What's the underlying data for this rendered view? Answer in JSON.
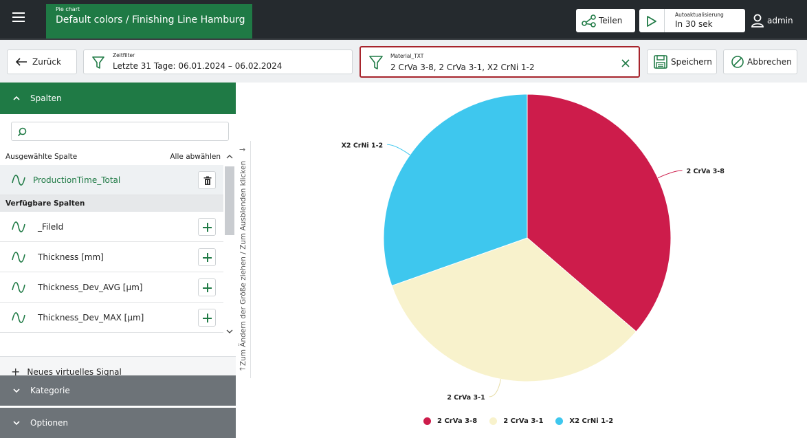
{
  "header": {
    "menu_icon": "hamburger-menu-icon",
    "title_small": "Pie chart",
    "title_main": "Default colors / Finishing Line Hamburg",
    "share_label": "Teilen",
    "share_icon": "share-network-icon",
    "auto_small": "Autoaktualisierung",
    "auto_main": "In 30 sek",
    "auto_icon": "play-icon",
    "user_label": "admin",
    "user_icon": "user-icon",
    "brand_color": "#1f7a45"
  },
  "toolbar": {
    "back_label": "Zurück",
    "back_icon": "arrow-left-icon",
    "time_filter_label": "Zeitfilter",
    "time_filter_value": "Letzte 31 Tage: 06.01.2024 – 06.02.2024",
    "material_filter_label": "Material_TXT",
    "material_filter_value": "2 CrVa 3-8, 2 CrVa 3-1, X2 CrNi 1-2",
    "filter_icon": "funnel-icon",
    "clear_icon": "close-icon",
    "save_label": "Speichern",
    "save_icon": "floppy-disk-icon",
    "cancel_label": "Abbrechen",
    "cancel_icon": "cancel-circle-icon",
    "highlight_color": "#a7242c"
  },
  "sidebar": {
    "columns_section": "Spalten",
    "search_placeholder": "",
    "search_icon": "search-icon",
    "selected_header": "Ausgewählte Spalte",
    "select_all": "Alle abwählen",
    "selected_column": "ProductionTime_Total",
    "available_header": "Verfügbare Spalten",
    "available_columns": [
      "_FileId",
      "Thickness [mm]",
      "Thickness_Dev_AVG [µm]",
      "Thickness_Dev_MAX [µm]"
    ],
    "signal_icon": "signal-wave-icon",
    "new_signal": "Neues virtuelles Signal",
    "category_section": "Kategorie",
    "options_section": "Optionen"
  },
  "resize_handle": {
    "text": "Zum Ändern der Größe ziehen / Zum Ausblenden klicken"
  },
  "chart_data": {
    "type": "pie",
    "title": "",
    "categories": [
      "2 CrVa 3-8",
      "2 CrVa 3-1",
      "X2 CrNi 1-2"
    ],
    "values": [
      36.3,
      33.3,
      30.4
    ],
    "colors": [
      "#cd1c4b",
      "#f8f2cc",
      "#3ec7ee"
    ],
    "legend": "bottom-center",
    "start_angle_deg": 0
  }
}
